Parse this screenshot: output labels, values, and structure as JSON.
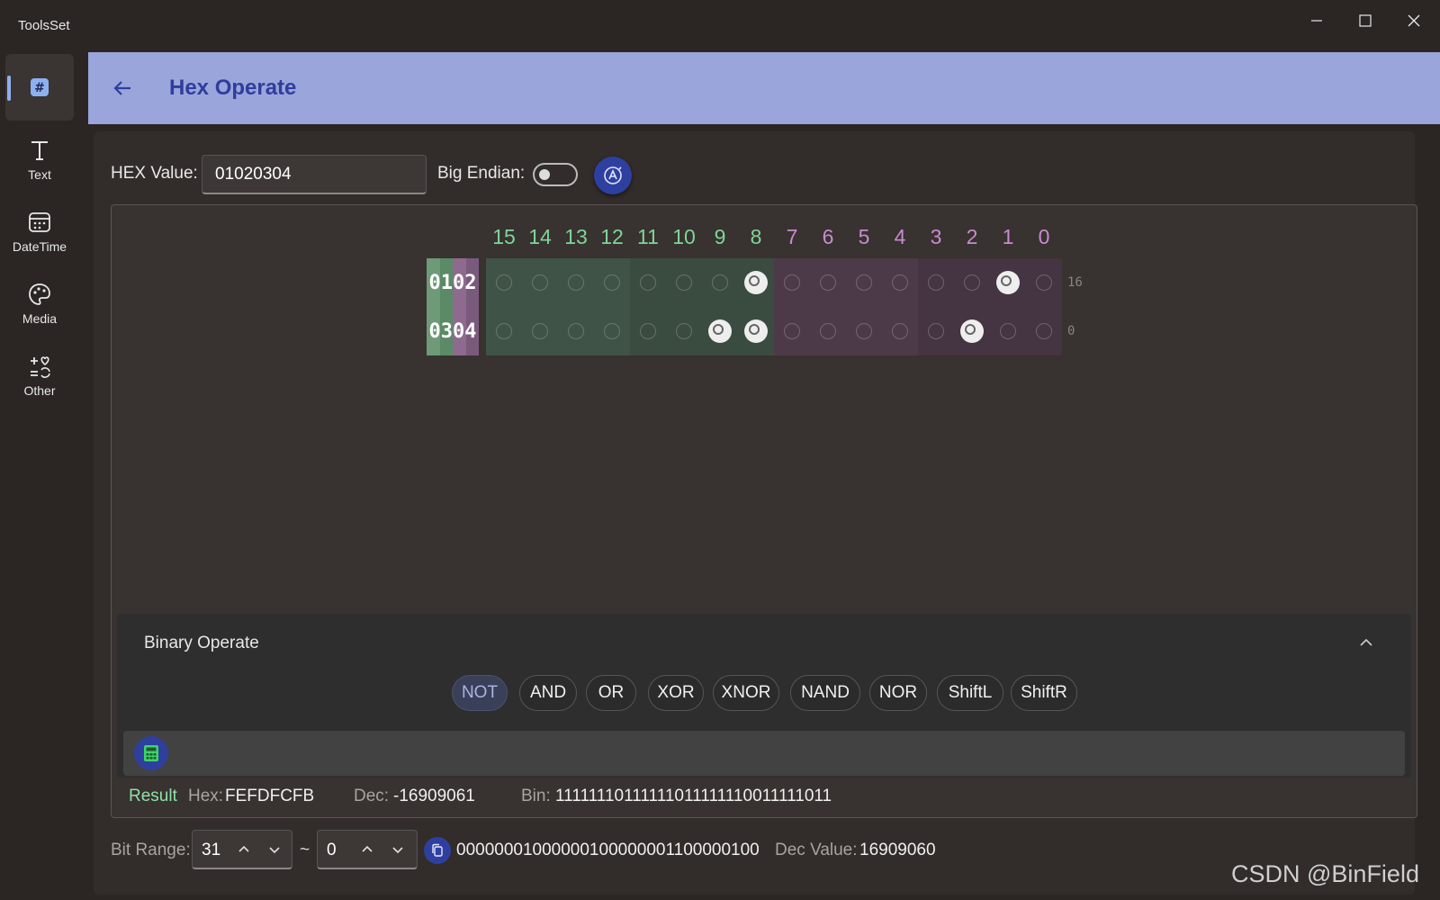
{
  "app": {
    "title": "ToolsSet"
  },
  "nav": [
    {
      "label": "",
      "icon": "hash-icon"
    },
    {
      "label": "Text",
      "icon": "text-icon"
    },
    {
      "label": "DateTime",
      "icon": "calendar-icon"
    },
    {
      "label": "Media",
      "icon": "palette-icon"
    },
    {
      "label": "Other",
      "icon": "shapes-icon"
    }
  ],
  "header": {
    "title": "Hex Operate"
  },
  "hex": {
    "label": "HEX Value:",
    "value": "01020304",
    "endian_label": "Big Endian:",
    "endian_on": false
  },
  "bits": {
    "headers": [
      "15",
      "14",
      "13",
      "12",
      "11",
      "10",
      "9",
      "8",
      "7",
      "6",
      "5",
      "4",
      "3",
      "2",
      "1",
      "0"
    ],
    "rows": [
      {
        "label": "0102",
        "suffix": "16",
        "set_bits": [
          8,
          1
        ]
      },
      {
        "label": "0304",
        "suffix": "0",
        "set_bits": [
          9,
          8,
          2
        ]
      }
    ]
  },
  "binop": {
    "title": "Binary Operate",
    "ops": [
      "NOT",
      "AND",
      "OR",
      "XOR",
      "XNOR",
      "NAND",
      "NOR",
      "ShiftL",
      "ShiftR"
    ],
    "active": "NOT"
  },
  "result": {
    "label": "Result",
    "hex_key": "Hex:",
    "hex_val": "FEFDFCFB",
    "dec_key": "Dec:",
    "dec_val": "-16909061",
    "bin_key": "Bin:",
    "bin_val": "11111110111111011111110011111011"
  },
  "range": {
    "label": "Bit Range:",
    "from": "31",
    "to": "0",
    "tilde": "~",
    "binary": "00000001000000100000001100000100",
    "dec_key": "Dec Value:",
    "dec_val": "16909060"
  },
  "watermark": "CSDN @BinField",
  "colors": {
    "header_bg": "#9aa5dc",
    "title": "#2f3d9c",
    "accent": "#2f3fa0",
    "high_byte": "#7fd49a",
    "low_byte": "#c98ad0"
  }
}
